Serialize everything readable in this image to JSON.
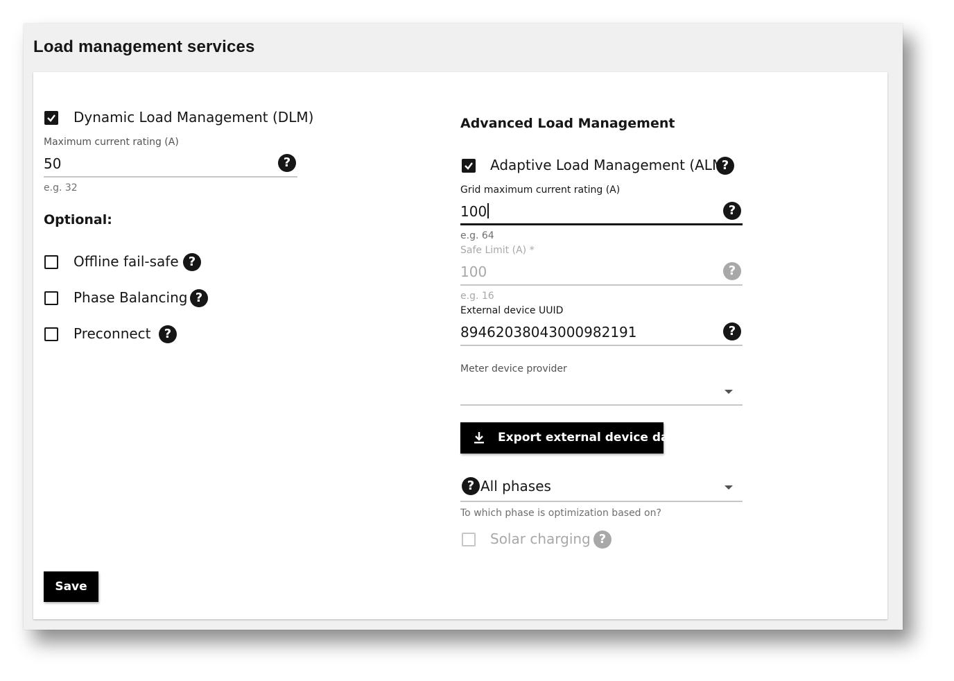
{
  "page": {
    "title": "Load management services"
  },
  "dlm": {
    "checkbox_label": "Dynamic Load Management (DLM)",
    "checked": true,
    "max_current": {
      "label": "Maximum current rating (A)",
      "value": "50",
      "hint": "e.g. 32"
    }
  },
  "optional": {
    "title": "Optional:",
    "items": [
      {
        "label": "Offline fail-safe",
        "checked": false
      },
      {
        "label": "Phase Balancing",
        "checked": false
      },
      {
        "label": "Preconnect",
        "checked": false
      }
    ]
  },
  "alm_section": {
    "title": "Advanced Load Management",
    "alm_checkbox_label": "Adaptive Load Management (ALM)",
    "alm_checked": true,
    "grid_max": {
      "label": "Grid maximum current rating (A)",
      "value": "100",
      "hint": "e.g. 64"
    },
    "safe_limit": {
      "label": "Safe Limit (A) *",
      "value": "100",
      "hint": "e.g. 16"
    },
    "uuid": {
      "label": "External device UUID",
      "value": "89462038043000982191"
    },
    "meter_provider": {
      "label": "Meter device provider",
      "value": ""
    },
    "export_button": "Export external device data",
    "phase_select": {
      "value": "All phases",
      "hint": "To which phase is optimization based on?"
    },
    "solar": {
      "label": "Solar charging",
      "checked": false
    }
  },
  "icons": {
    "help": "?"
  },
  "save_button": "Save"
}
